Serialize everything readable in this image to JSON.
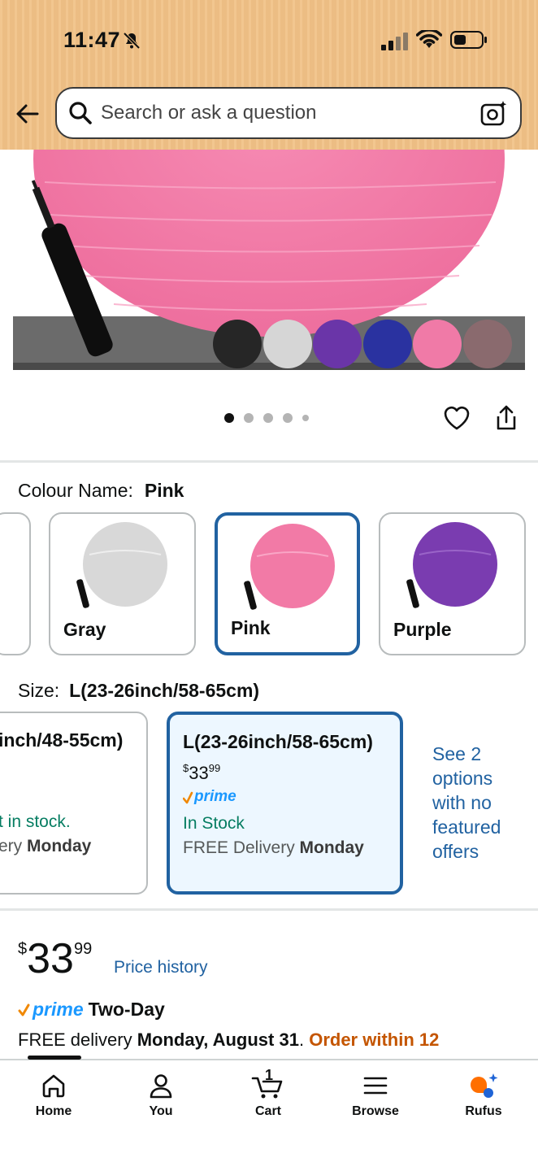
{
  "status_bar": {
    "time": "11:47"
  },
  "search": {
    "placeholder": "Search or ask a question"
  },
  "image_carousel": {
    "total_dots": 5,
    "active_index": 0
  },
  "colour": {
    "label": "Colour Name:",
    "selected": "Pink",
    "options": [
      {
        "name": "Gray",
        "color": "#d8d8d8"
      },
      {
        "name": "Pink",
        "color": "#f27aa6"
      },
      {
        "name": "Purple",
        "color": "#7a3cb0"
      }
    ]
  },
  "size": {
    "label": "Size:",
    "selected": "L(23-26inch/58-65cm)",
    "options": [
      {
        "title": "inch/48-55cm)",
        "stock": "t in stock.",
        "delivery_prefix": "ery ",
        "delivery_day": "Monday"
      },
      {
        "title": "L(23-26inch/58-65cm)",
        "price_symbol": "$",
        "price_whole": "33",
        "price_fraction": "99",
        "prime": "prime",
        "stock": "In Stock",
        "delivery_prefix": "FREE Delivery ",
        "delivery_day": "Monday"
      }
    ],
    "see_options": "See 2 options with no featured offers"
  },
  "buy_box": {
    "price_symbol": "$",
    "price_whole": "33",
    "price_fraction": "99",
    "price_history": "Price history",
    "prime": "prime",
    "two_day": "Two-Day",
    "delivery_text": "FREE delivery ",
    "delivery_date": "Monday, August 31",
    "delivery_sep": ". ",
    "order_within": "Order within 12"
  },
  "bottom_nav": {
    "items": [
      {
        "label": "Home",
        "icon": "home-icon"
      },
      {
        "label": "You",
        "icon": "person-icon"
      },
      {
        "label": "Cart",
        "icon": "cart-icon",
        "badge": "1"
      },
      {
        "label": "Browse",
        "icon": "menu-icon"
      },
      {
        "label": "Rufus",
        "icon": "rufus-icon"
      }
    ]
  },
  "colors": {
    "link": "#2162a1",
    "selected_border": "#2162a1",
    "in_stock": "#067d62",
    "prime": "#1a98ff",
    "check": "#f08804",
    "order_within": "#c45500",
    "header_bg": "#f1c186"
  }
}
